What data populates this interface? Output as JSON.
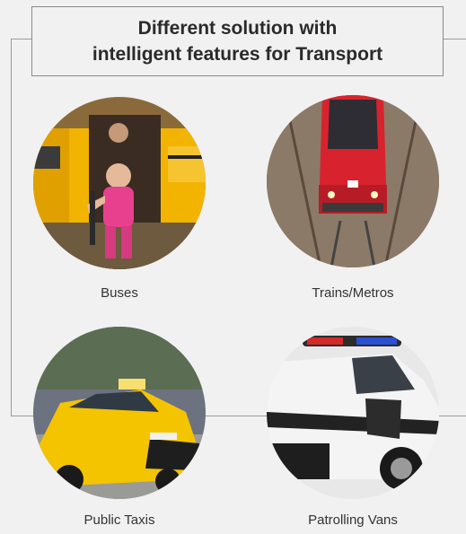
{
  "title": "Different solution with\nintelligent features for Transport",
  "tiles": [
    {
      "label": "Buses",
      "icon": "school-bus-photo"
    },
    {
      "label": "Trains/Metros",
      "icon": "train-photo"
    },
    {
      "label": "Public Taxis",
      "icon": "taxi-photo"
    },
    {
      "label": "Patrolling Vans",
      "icon": "patrol-van-photo"
    }
  ],
  "colors": {
    "bus": "#f2b400",
    "train": "#d8232e",
    "taxi": "#f4c400",
    "van": "#f4f4f4"
  }
}
